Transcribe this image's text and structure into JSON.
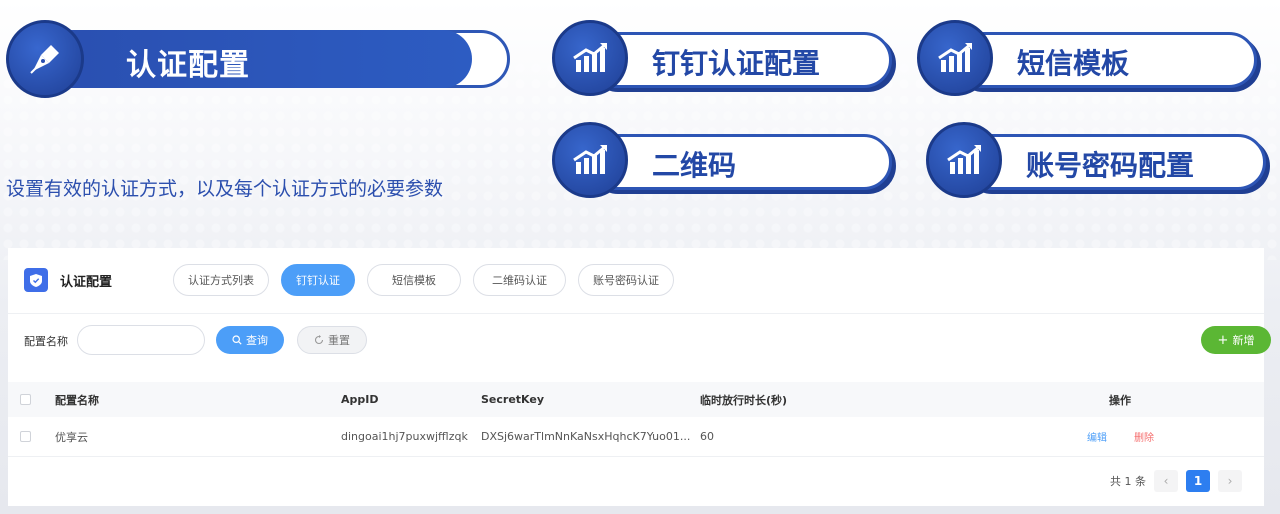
{
  "header": {
    "title": "认证配置",
    "subtitle": "设置有效的认证方式，以及每个认证方式的必要参数"
  },
  "cards": [
    {
      "label": "钉钉认证配置"
    },
    {
      "label": "短信模板"
    },
    {
      "label": "二维码"
    },
    {
      "label": "账号密码配置"
    }
  ],
  "panel": {
    "title": "认证配置",
    "tabs": [
      {
        "label": "认证方式列表",
        "active": false
      },
      {
        "label": "钉钉认证",
        "active": true
      },
      {
        "label": "短信模板",
        "active": false
      },
      {
        "label": "二维码认证",
        "active": false
      },
      {
        "label": "账号密码认证",
        "active": false
      }
    ]
  },
  "search": {
    "label": "配置名称",
    "value": "",
    "placeholder": "",
    "query_label": "查询",
    "reset_label": "重置",
    "add_label": "新增"
  },
  "table": {
    "columns": [
      "配置名称",
      "AppID",
      "SecretKey",
      "临时放行时长(秒)",
      "操作"
    ],
    "rows": [
      {
        "name": "优享云",
        "appid": "dingoai1hj7puxwjfflzqk",
        "secret": "DXSj6warTlmNnKaNsxHqhcK7Yuo01...",
        "duration": "60",
        "edit": "编辑",
        "delete": "删除"
      }
    ]
  },
  "pagination": {
    "total_text": "共 1 条",
    "current_page": "1",
    "prev": "‹",
    "next": "›"
  },
  "colors": {
    "primary_blue": "#2d55b5",
    "accent_blue": "#4c9ef8",
    "add_green": "#5bb734",
    "delete_red": "#f56c6c"
  }
}
